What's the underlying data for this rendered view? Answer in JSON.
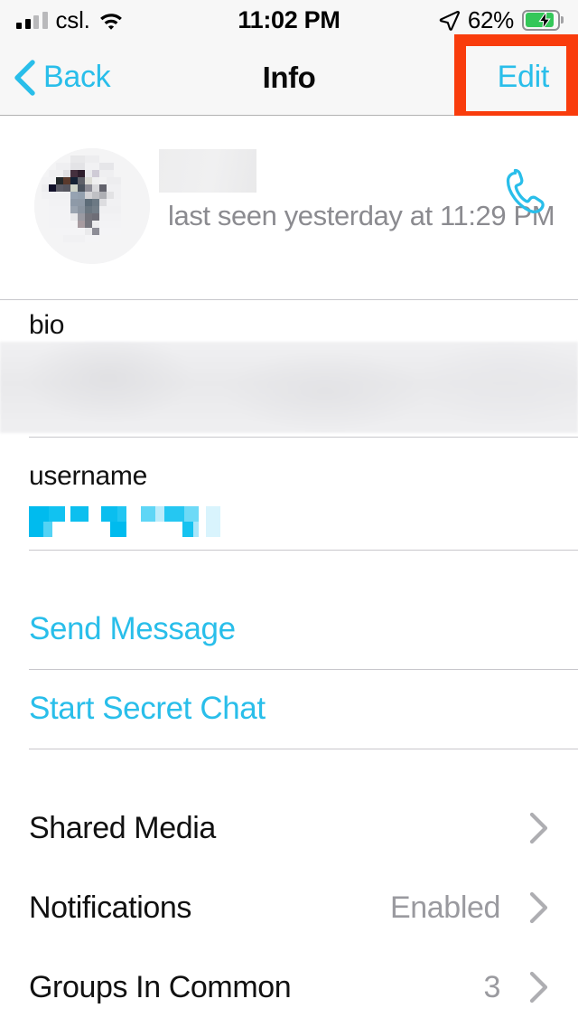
{
  "status_bar": {
    "carrier": "csl.",
    "signal_bars_filled": 2,
    "signal_bars_total": 4,
    "wifi_icon": "wifi-icon",
    "time": "11:02 PM",
    "location_icon": "location-arrow-icon",
    "battery_percent": "62%",
    "battery_level": 62,
    "battery_charging": true,
    "battery_color": "#34C759"
  },
  "nav_bar": {
    "back_label": "Back",
    "back_icon": "chevron-left-icon",
    "title": "Info",
    "edit_label": "Edit",
    "accent_color": "#29BEEA",
    "background_color": "#F7F7F7"
  },
  "annotation": {
    "highlight_target": "Edit",
    "highlight_color": "#F93C0C"
  },
  "profile": {
    "avatar": "redacted-pixelated-avatar",
    "name": "",
    "name_redacted": true,
    "last_seen": "last seen yesterday at 11:29 PM",
    "call_icon": "phone-handset-icon"
  },
  "bio_section": {
    "label": "bio",
    "value": "",
    "value_redacted": true
  },
  "username_section": {
    "label": "username",
    "value": "",
    "value_redacted": true,
    "redaction_color": "#00BFF0"
  },
  "actions": [
    {
      "label": "Send Message",
      "name": "send-message-action"
    },
    {
      "label": "Start Secret Chat",
      "name": "start-secret-chat-action"
    }
  ],
  "list_rows": [
    {
      "title": "Shared Media",
      "value": "",
      "chevron": true,
      "name": "shared-media-row"
    },
    {
      "title": "Notifications",
      "value": "Enabled",
      "chevron": true,
      "name": "notifications-row"
    },
    {
      "title": "Groups In Common",
      "value": "3",
      "chevron": true,
      "name": "groups-in-common-row"
    }
  ]
}
